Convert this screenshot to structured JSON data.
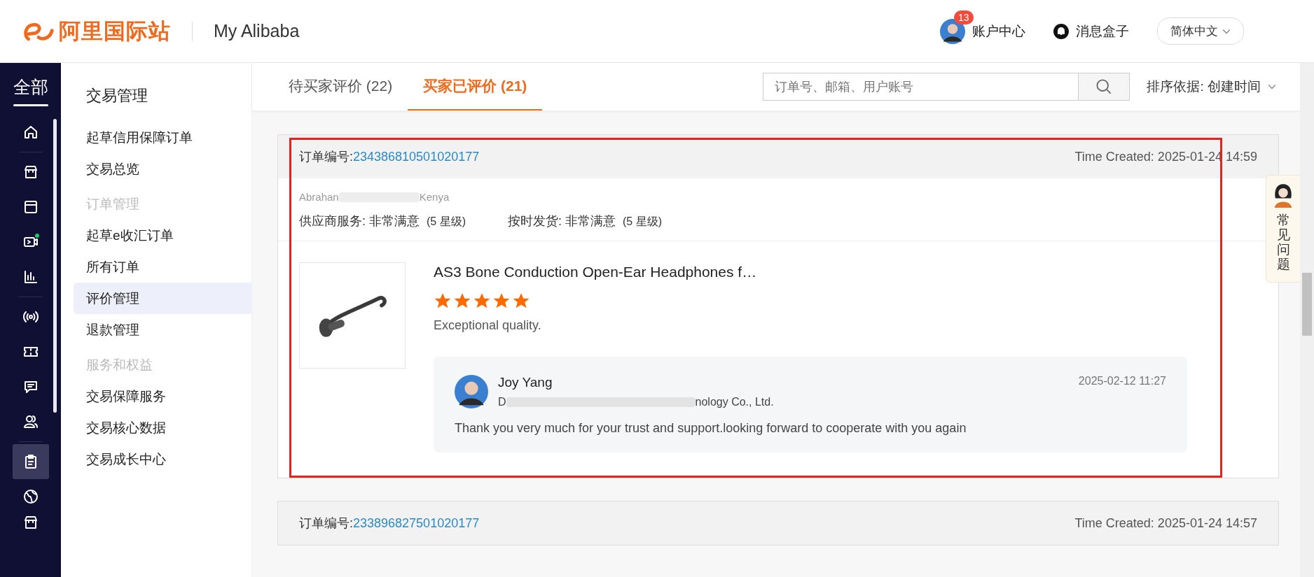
{
  "header": {
    "logo_text": "阿里国际站",
    "title": "My Alibaba",
    "account": {
      "badge": "13",
      "label": "账户中心"
    },
    "messages": "消息盒子",
    "language": "简体中文"
  },
  "rail": {
    "title": "全部",
    "items": [
      {
        "kind": "home",
        "selected": false,
        "notification": false
      },
      {
        "kind": "store",
        "selected": false,
        "notification": false
      },
      {
        "kind": "window",
        "selected": false,
        "notification": false
      },
      {
        "kind": "video",
        "selected": false,
        "notification": true
      },
      {
        "kind": "chart",
        "selected": false,
        "notification": false
      },
      {
        "kind": "broadcast",
        "selected": false,
        "notification": false
      },
      {
        "kind": "ticket",
        "selected": false,
        "notification": false
      },
      {
        "kind": "chat",
        "selected": false,
        "notification": false
      },
      {
        "kind": "users",
        "selected": false,
        "notification": false
      },
      {
        "kind": "clipboard",
        "selected": true,
        "notification": false
      },
      {
        "kind": "globe",
        "selected": false,
        "notification": false
      },
      {
        "kind": "partial",
        "selected": false,
        "notification": false
      }
    ]
  },
  "sidebar": {
    "title": "交易管理",
    "items": [
      {
        "kind": "link",
        "label": "起草信用保障订单",
        "selected": false
      },
      {
        "kind": "link",
        "label": "交易总览",
        "selected": false
      },
      {
        "kind": "group",
        "label": "订单管理",
        "selected": false
      },
      {
        "kind": "link",
        "label": "起草e收汇订单",
        "selected": false
      },
      {
        "kind": "link",
        "label": "所有订单",
        "selected": false
      },
      {
        "kind": "link",
        "label": "评价管理",
        "selected": true
      },
      {
        "kind": "link",
        "label": "退款管理",
        "selected": false
      },
      {
        "kind": "group",
        "label": "服务和权益",
        "selected": false
      },
      {
        "kind": "link",
        "label": "交易保障服务",
        "selected": false
      },
      {
        "kind": "link",
        "label": "交易核心数据",
        "selected": false
      },
      {
        "kind": "link",
        "label": "交易成长中心",
        "selected": false
      }
    ]
  },
  "tabs": [
    {
      "label": "待买家评价 (22)",
      "selected": false
    },
    {
      "label": "买家已评价 (21)",
      "selected": true
    }
  ],
  "search": {
    "placeholder": "订单号、邮箱、用户账号"
  },
  "sort": "排序依据: 创建时间",
  "reviews": [
    {
      "order_label": "订单编号:",
      "order_no": "234386810501020177",
      "time": "Time Created: 2025-01-24 14:59",
      "highlighted": true,
      "buyer": [
        "Abrahan",
        "Kenya"
      ],
      "ratings": [
        {
          "label": "供应商服务: 非常满意",
          "grade": "(5 星级)"
        },
        {
          "label": "按时发货: 非常满意",
          "grade": "(5 星级)"
        }
      ],
      "product_title": "AS3 Bone Conduction Open-Ear Headphones f…",
      "stars": 5,
      "comment": "Exceptional quality.",
      "reply": {
        "name": "Joy Yang",
        "company": [
          "D",
          "nology Co., Ltd."
        ],
        "time": "2025-02-12 11:27",
        "text": "Thank you very much for your trust and support.looking forward to cooperate with you again"
      }
    },
    {
      "order_label": "订单编号:",
      "order_no": "233896827501020177",
      "time": "Time Created: 2025-01-24 14:57",
      "highlighted": false
    }
  ],
  "help": "常见问题"
}
